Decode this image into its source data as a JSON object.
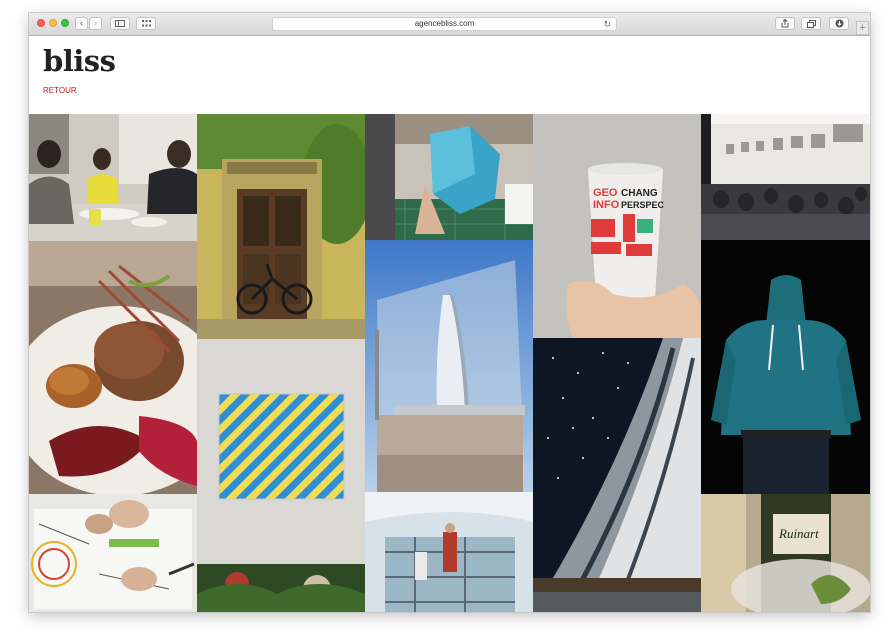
{
  "browser": {
    "url": "agencebliss.com",
    "new_tab_label": "+"
  },
  "site": {
    "logo": "bliss",
    "back_link": "RETOUR"
  },
  "gallery": {
    "cup_text_1": "GEO",
    "cup_text_2": "INFO",
    "cup_text_3": "CHANG",
    "cup_text_4": "PERSPEC",
    "bottle_label": "Ruinart"
  }
}
